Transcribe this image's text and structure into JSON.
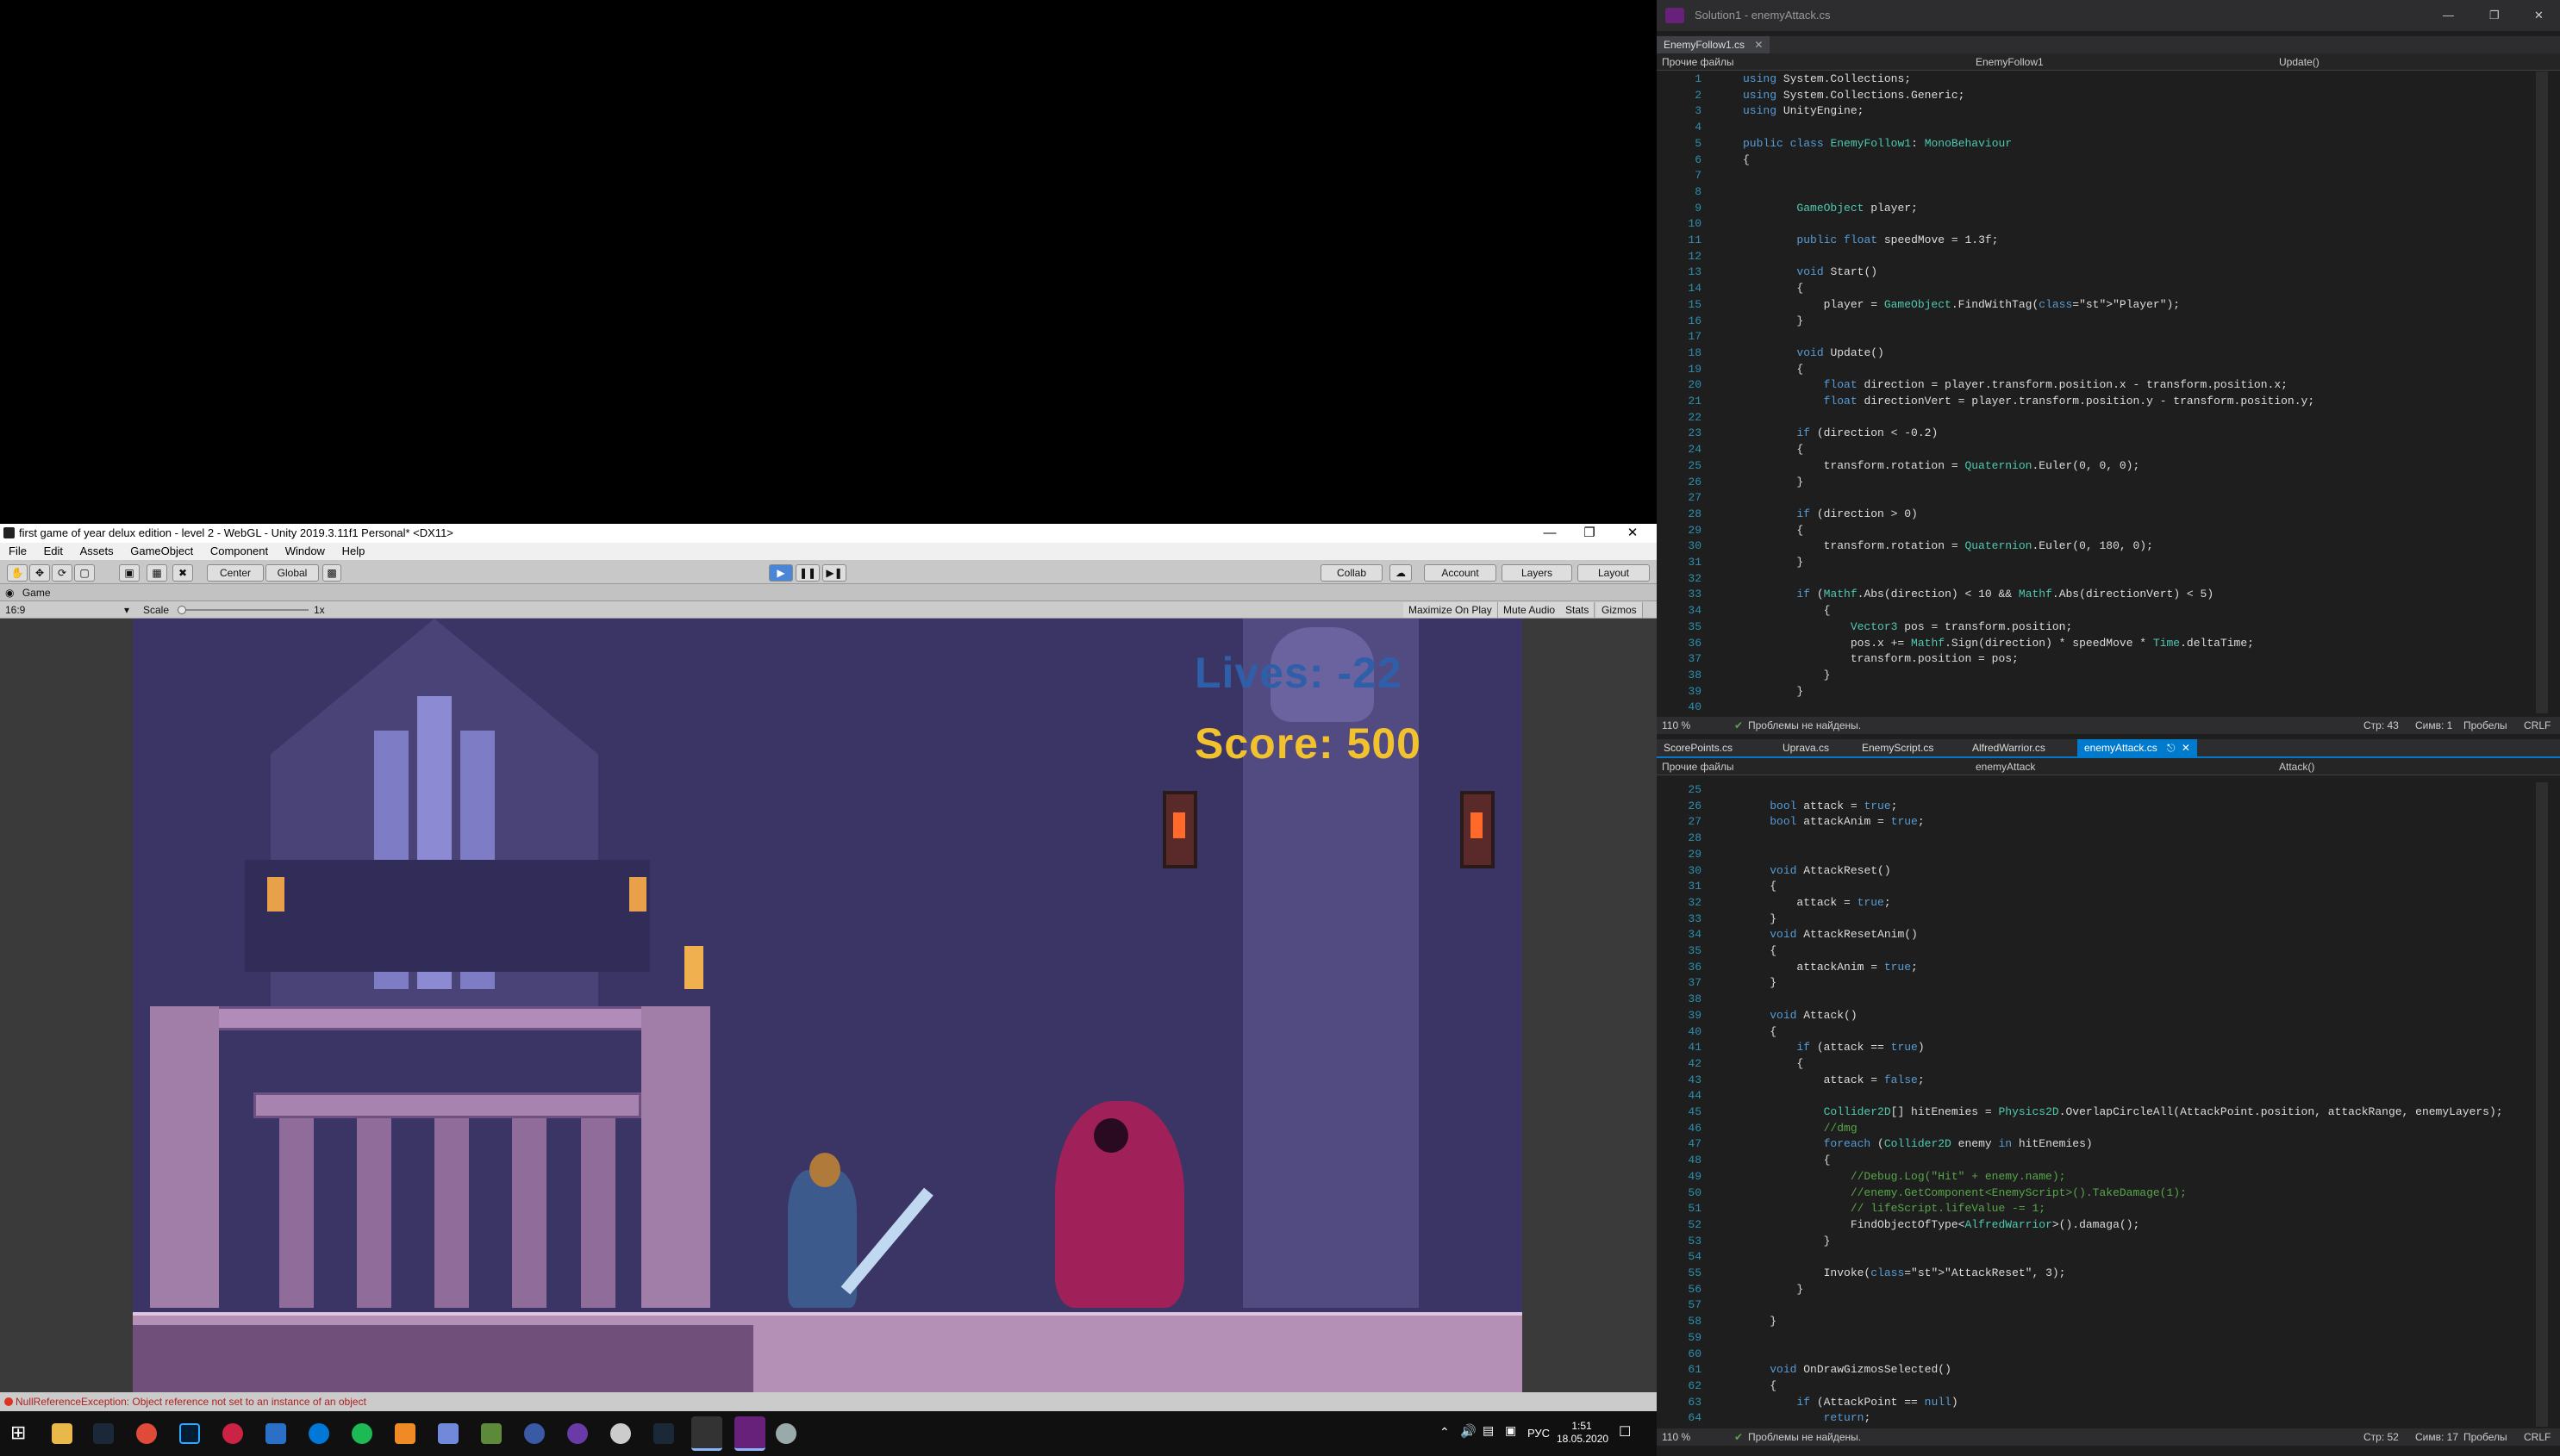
{
  "unity": {
    "title": "first game of year delux edition - level 2 - WebGL - Unity 2019.3.11f1 Personal* <DX11>",
    "menu": [
      "File",
      "Edit",
      "Assets",
      "GameObject",
      "Component",
      "Window",
      "Help"
    ],
    "toolbar": {
      "center": "Center",
      "global": "Global",
      "collab": "Collab",
      "account": "Account",
      "layers": "Layers",
      "layout": "Layout"
    },
    "game_tab": "Game",
    "aspect": "16:9",
    "scale_label": "Scale",
    "scale_value": "1x",
    "game_buttons": [
      "Maximize On Play",
      "Mute Audio",
      "Stats",
      "Gizmos"
    ],
    "hud": {
      "lives": "Lives: -22",
      "score": "Score: 500"
    },
    "status_error": "NullReferenceException: Object reference not set to an instance of an object"
  },
  "vs": {
    "title": "Solution1 - enemyAttack.cs",
    "top_tab": "EnemyFollow1.cs",
    "top_nav": {
      "files": "Прочие файлы",
      "class": "EnemyFollow1",
      "method": "Update()"
    },
    "top_code": [
      {
        "n": "1",
        "t": "using System.Collections;"
      },
      {
        "n": "2",
        "t": "using System.Collections.Generic;"
      },
      {
        "n": "3",
        "t": "using UnityEngine;"
      },
      {
        "n": "4",
        "t": ""
      },
      {
        "n": "5",
        "t": "public class EnemyFollow1: MonoBehaviour"
      },
      {
        "n": "6",
        "t": "{"
      },
      {
        "n": "7",
        "t": ""
      },
      {
        "n": "8",
        "t": ""
      },
      {
        "n": "9",
        "t": "        GameObject player;"
      },
      {
        "n": "10",
        "t": ""
      },
      {
        "n": "11",
        "t": "        public float speedMove = 1.3f;"
      },
      {
        "n": "12",
        "t": ""
      },
      {
        "n": "13",
        "t": "        void Start()"
      },
      {
        "n": "14",
        "t": "        {"
      },
      {
        "n": "15",
        "t": "            player = GameObject.FindWithTag(\"Player\");"
      },
      {
        "n": "16",
        "t": "        }"
      },
      {
        "n": "17",
        "t": ""
      },
      {
        "n": "18",
        "t": "        void Update()"
      },
      {
        "n": "19",
        "t": "        {"
      },
      {
        "n": "20",
        "t": "            float direction = player.transform.position.x - transform.position.x;"
      },
      {
        "n": "21",
        "t": "            float directionVert = player.transform.position.y - transform.position.y;"
      },
      {
        "n": "22",
        "t": ""
      },
      {
        "n": "23",
        "t": "        if (direction < -0.2)"
      },
      {
        "n": "24",
        "t": "        {"
      },
      {
        "n": "25",
        "t": "            transform.rotation = Quaternion.Euler(0, 0, 0);"
      },
      {
        "n": "26",
        "t": "        }"
      },
      {
        "n": "27",
        "t": ""
      },
      {
        "n": "28",
        "t": "        if (direction > 0)"
      },
      {
        "n": "29",
        "t": "        {"
      },
      {
        "n": "30",
        "t": "            transform.rotation = Quaternion.Euler(0, 180, 0);"
      },
      {
        "n": "31",
        "t": "        }"
      },
      {
        "n": "32",
        "t": ""
      },
      {
        "n": "33",
        "t": "        if (Mathf.Abs(direction) < 10 && Mathf.Abs(directionVert) < 5)"
      },
      {
        "n": "34",
        "t": "            {"
      },
      {
        "n": "35",
        "t": "                Vector3 pos = transform.position;"
      },
      {
        "n": "36",
        "t": "                pos.x += Mathf.Sign(direction) * speedMove * Time.deltaTime;"
      },
      {
        "n": "37",
        "t": "                transform.position = pos;"
      },
      {
        "n": "38",
        "t": "            }"
      },
      {
        "n": "39",
        "t": "        }"
      },
      {
        "n": "40",
        "t": ""
      }
    ],
    "top_status": {
      "zoom": "110 %",
      "problems": "Проблемы не найдены.",
      "pos": "Стр: 43",
      "col": "Симв: 1",
      "spaces": "Пробелы",
      "eol": "CRLF"
    },
    "bottom_tabs": [
      "ScorePoints.cs",
      "Uprava.cs",
      "EnemyScript.cs",
      "AlfredWarrior.cs",
      "enemyAttack.cs"
    ],
    "bottom_nav": {
      "files": "Прочие файлы",
      "class": "enemyAttack",
      "method": "Attack()"
    },
    "bottom_code": [
      {
        "n": "25",
        "t": ""
      },
      {
        "n": "26",
        "t": "    bool attack = true;"
      },
      {
        "n": "27",
        "t": "    bool attackAnim = true;"
      },
      {
        "n": "28",
        "t": ""
      },
      {
        "n": "29",
        "t": ""
      },
      {
        "n": "30",
        "t": "    void AttackReset()"
      },
      {
        "n": "31",
        "t": "    {"
      },
      {
        "n": "32",
        "t": "        attack = true;"
      },
      {
        "n": "33",
        "t": "    }"
      },
      {
        "n": "34",
        "t": "    void AttackResetAnim()"
      },
      {
        "n": "35",
        "t": "    {"
      },
      {
        "n": "36",
        "t": "        attackAnim = true;"
      },
      {
        "n": "37",
        "t": "    }"
      },
      {
        "n": "38",
        "t": ""
      },
      {
        "n": "39",
        "t": "    void Attack()"
      },
      {
        "n": "40",
        "t": "    {"
      },
      {
        "n": "41",
        "t": "        if (attack == true)"
      },
      {
        "n": "42",
        "t": "        {"
      },
      {
        "n": "43",
        "t": "            attack = false;"
      },
      {
        "n": "44",
        "t": ""
      },
      {
        "n": "45",
        "t": "            Collider2D[] hitEnemies = Physics2D.OverlapCircleAll(AttackPoint.position, attackRange, enemyLayers);"
      },
      {
        "n": "46",
        "t": "            //dmg"
      },
      {
        "n": "47",
        "t": "            foreach (Collider2D enemy in hitEnemies)"
      },
      {
        "n": "48",
        "t": "            {"
      },
      {
        "n": "49",
        "t": "                //Debug.Log(\"Hit\" + enemy.name);"
      },
      {
        "n": "50",
        "t": "                //enemy.GetComponent<EnemyScript>().TakeDamage(1);"
      },
      {
        "n": "51",
        "t": "                // lifeScript.lifeValue -= 1;"
      },
      {
        "n": "52",
        "t": "                FindObjectOfType<AlfredWarrior>().damaga();"
      },
      {
        "n": "53",
        "t": "            }"
      },
      {
        "n": "54",
        "t": ""
      },
      {
        "n": "55",
        "t": "            Invoke(\"AttackReset\", 3);"
      },
      {
        "n": "56",
        "t": "        }"
      },
      {
        "n": "57",
        "t": ""
      },
      {
        "n": "58",
        "t": "    }"
      },
      {
        "n": "59",
        "t": ""
      },
      {
        "n": "60",
        "t": ""
      },
      {
        "n": "61",
        "t": "    void OnDrawGizmosSelected()"
      },
      {
        "n": "62",
        "t": "    {"
      },
      {
        "n": "63",
        "t": "        if (AttackPoint == null)"
      },
      {
        "n": "64",
        "t": "            return;"
      }
    ],
    "bottom_status": {
      "zoom": "110 %",
      "problems": "Проблемы не найдены.",
      "pos": "Стр: 52",
      "col": "Симв: 17",
      "spaces": "Пробелы",
      "eol": "CRLF"
    }
  },
  "taskbar": {
    "lang": "РУС",
    "time": "1:51",
    "date": "18.05.2020"
  },
  "colors": {
    "vs_accent": "#007acc",
    "unity_play": "#4a85d8",
    "lives": "#2f5fa8",
    "score": "#f2c12e"
  }
}
